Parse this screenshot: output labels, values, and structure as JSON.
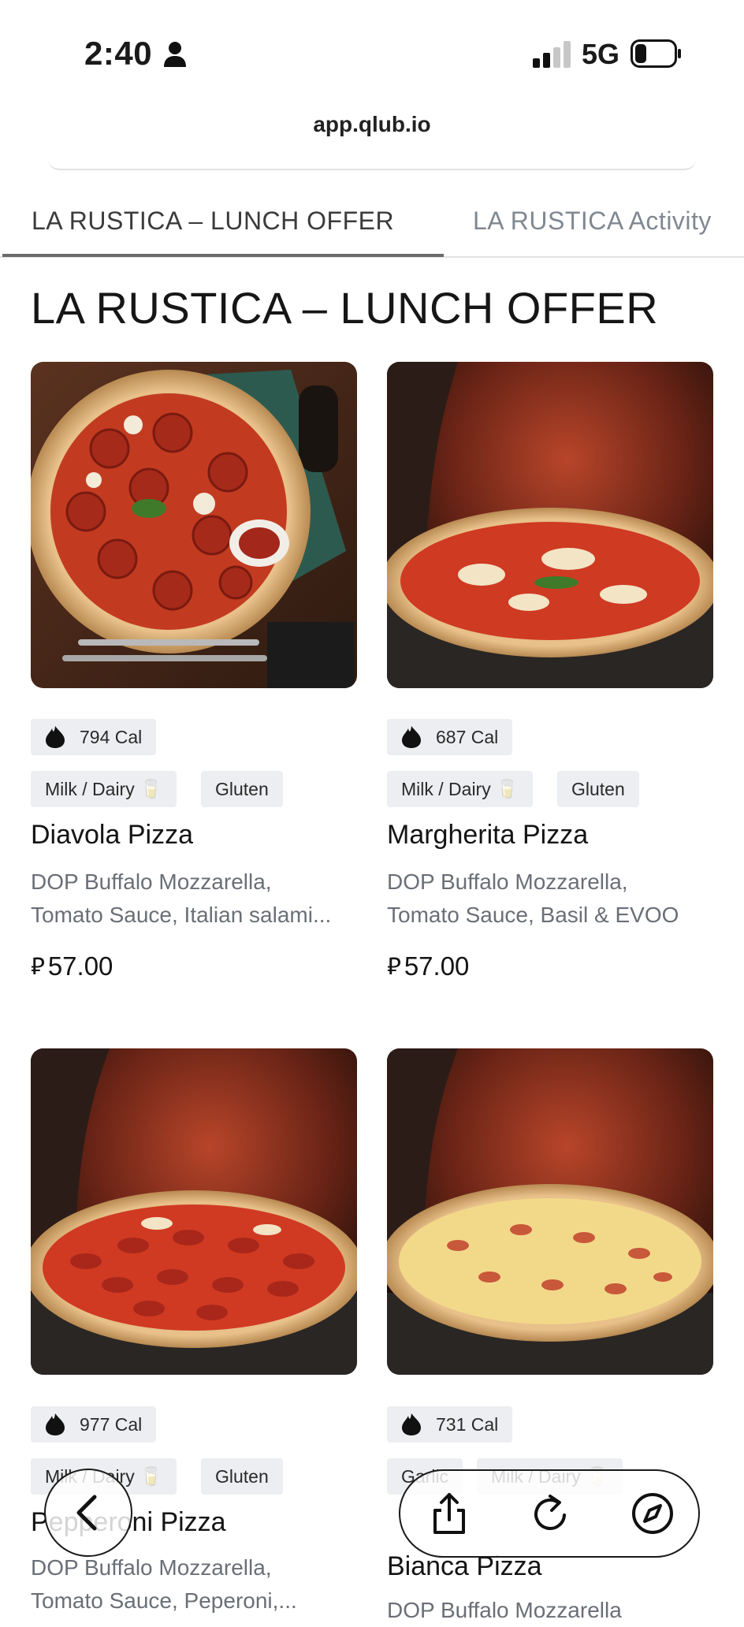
{
  "status_bar": {
    "time": "2:40",
    "network": "5G"
  },
  "browser": {
    "url": "app.qlub.io"
  },
  "tabs": [
    {
      "label": "LA RUSTICA – LUNCH OFFER",
      "active": true
    },
    {
      "label": "LA RUSTICA Activity",
      "active": false
    }
  ],
  "section_title": "LA RUSTICA – LUNCH OFFER",
  "currency_symbol": "⃁",
  "items": [
    {
      "calories": "794 Cal",
      "tags": [
        "Milk / Dairy 🥛",
        "Gluten"
      ],
      "name": "Diavola Pizza",
      "description_line1": "DOP Buffalo Mozzarella,",
      "description_line2": "Tomato Sauce, Italian salami...",
      "price": "57.00"
    },
    {
      "calories": "687 Cal",
      "tags": [
        "Milk / Dairy 🥛",
        "Gluten"
      ],
      "name": "Margherita Pizza",
      "description_line1": "DOP Buffalo Mozzarella,",
      "description_line2": "Tomato Sauce, Basil & EVOO",
      "price": "57.00"
    },
    {
      "calories": "977 Cal",
      "tags": [
        "Milk / Dairy 🥛",
        "Gluten"
      ],
      "name": "Pepperoni Pizza",
      "description_line1": "DOP Buffalo Mozzarella,",
      "description_line2": "Tomato Sauce, Peperoni,..."
    },
    {
      "calories": "731 Cal",
      "tags": [
        "Garlic",
        "Milk / Dairy 🥛"
      ],
      "name": "Bianca Pizza",
      "description_line1": "DOP Buffalo Mozzarella"
    }
  ],
  "colors": {
    "chip_bg": "#eceef1",
    "tab_active_indicator": "#6b6b6b",
    "muted_text": "#6a6f77"
  },
  "icons": [
    "person-icon",
    "signal-icon",
    "battery-icon",
    "flame-icon",
    "back-icon",
    "share-icon",
    "reload-icon",
    "compass-icon"
  ]
}
